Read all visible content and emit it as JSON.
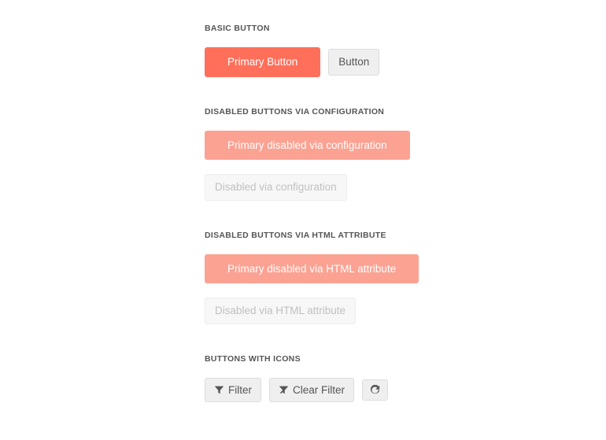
{
  "sections": {
    "basic": {
      "title": "BASIC BUTTON",
      "primary_label": "Primary Button",
      "secondary_label": "Button"
    },
    "disabled_config": {
      "title": "DISABLED BUTTONS VIA CONFIGURATION",
      "primary_label": "Primary disabled via configuration",
      "secondary_label": "Disabled via configuration"
    },
    "disabled_html": {
      "title": "DISABLED BUTTONS VIA HTML ATTRIBUTE",
      "primary_label": "Primary disabled via HTML attribute",
      "secondary_label": "Disabled via HTML attribute"
    },
    "icons": {
      "title": "BUTTONS WITH ICONS",
      "filter_label": "Filter",
      "clear_filter_label": "Clear Filter"
    }
  }
}
